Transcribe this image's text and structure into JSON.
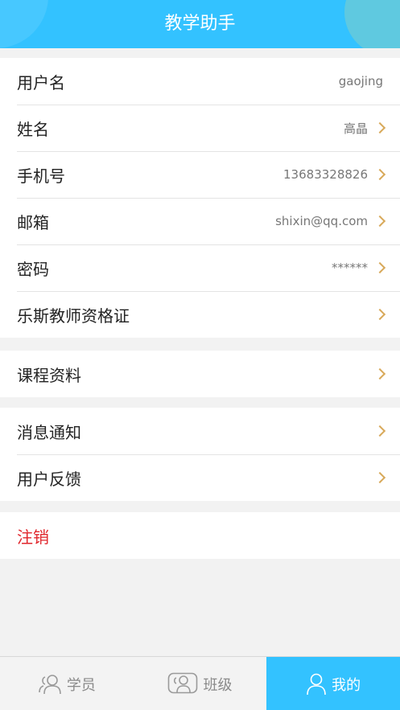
{
  "header": {
    "title": "教学助手"
  },
  "account": {
    "username_label": "用户名",
    "username_value": "gaojing",
    "name_label": "姓名",
    "name_value": "高晶",
    "phone_label": "手机号",
    "phone_value": "13683328826",
    "email_label": "邮箱",
    "email_value": "shixin@qq.com",
    "password_label": "密码",
    "password_value": "******",
    "cert_label": "乐斯教师资格证"
  },
  "materials": {
    "course_label": "课程资料"
  },
  "support": {
    "notify_label": "消息通知",
    "feedback_label": "用户反馈"
  },
  "logout": {
    "label": "注销"
  },
  "tabs": [
    {
      "label": "学员",
      "icon": "students-icon"
    },
    {
      "label": "班级",
      "icon": "class-icon"
    },
    {
      "label": "我的",
      "icon": "profile-icon"
    }
  ],
  "colors": {
    "accent": "#33c2ff",
    "chevron": "#d8a95a",
    "danger": "#e0262c"
  }
}
